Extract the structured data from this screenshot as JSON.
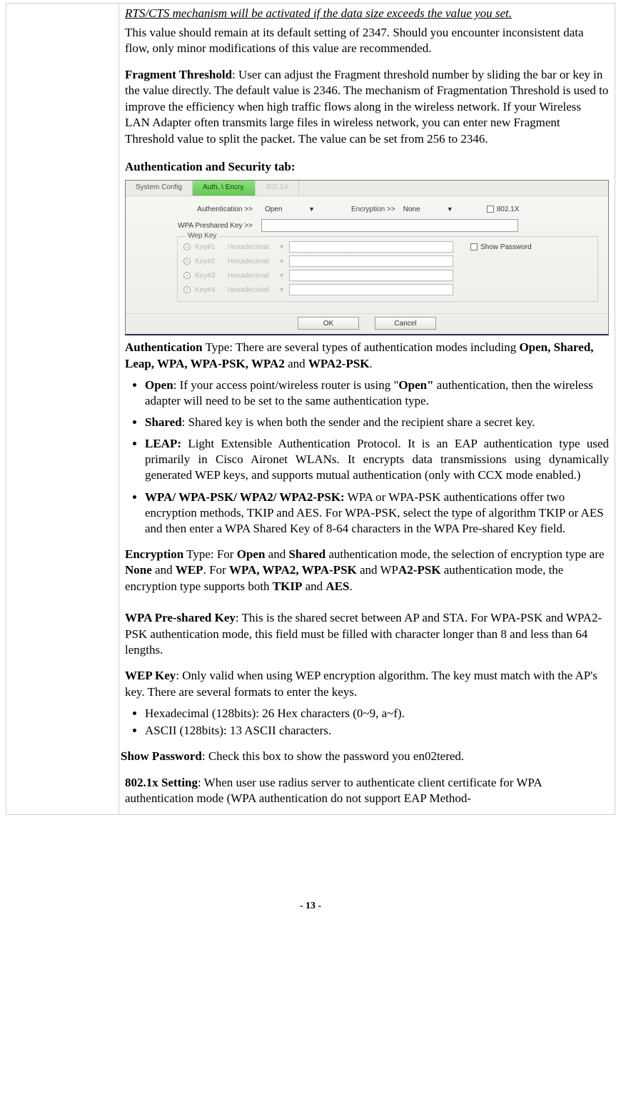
{
  "para_rts_note": "RTS/CTS mechanism will be activated if the data size exceeds the value you set.",
  "para_rts_default": "This value should remain at its default setting of 2347.   Should you encounter inconsistent data flow, only minor modifications of this value are recommended.",
  "frag_label": "Fragment Threshold",
  "frag_text": ": User can adjust the Fragment threshold number by sliding the bar or key in the value directly. The default value is 2346. The mechanism of Fragmentation Threshold is used to improve the efficiency when high traffic flows along in the wireless network. If your Wireless LAN Adapter often transmits large files in wireless network, you can enter new Fragment Threshold value to split the packet.   The value can be set from 256 to 2346.",
  "auth_sec_title": "Authentication and Security tab:",
  "ui": {
    "tabs": {
      "system": "System Config",
      "auth": "Auth. \\ Encry.",
      "dot1x": "802.1X"
    },
    "auth_lbl": "Authentication >>",
    "auth_val": "Open",
    "enc_lbl": "Encryption >>",
    "enc_val": "None",
    "cb_8021x": "802.1X",
    "psk_lbl": "WPA Preshared Key >>",
    "wep_legend": "Wep Key",
    "keys": [
      {
        "name": "Key#1",
        "fmt": "Hexadecimal"
      },
      {
        "name": "Key#2",
        "fmt": "Hexadecimal"
      },
      {
        "name": "Key#3",
        "fmt": "Hexadecimal"
      },
      {
        "name": "Key#4",
        "fmt": "Hexadecimal"
      }
    ],
    "show_pw": "Show Password",
    "ok": "OK",
    "cancel": "Cancel"
  },
  "auth_type_lead_b": "Authentication",
  "auth_type_lead_rest": " Type: There are several types of authentication modes including ",
  "auth_type_list_b": "Open, Shared, Leap, WPA, WPA-PSK, WPA2",
  "auth_type_and": " and ",
  "auth_type_last_b": "WPA2-PSK",
  "bullets_auth": {
    "open_b": "Open",
    "open_t1": ": If your access point/wireless router is using \"",
    "open_t1b": "Open\"",
    "open_t2": " authentication, then the wireless adapter will need to be set to the same authentication type.",
    "shared_b": "Shared",
    "shared_t": ": Shared key is when both the sender and the recipient share a secret key.",
    "leap_b": "LEAP:",
    "leap_t": " Light Extensible Authentication Protocol. It is an EAP authentication type used primarily in Cisco Aironet WLANs. It encrypts data transmissions using dynamically generated WEP keys, and supports mutual authentication (only with CCX mode enabled.)",
    "wpa_b": "WPA/ WPA-PSK/ WPA2/ WPA2-PSK:",
    "wpa_t": " WPA or WPA-PSK authentications offer two encryption methods, TKIP and AES. For WPA-PSK, select the type of algorithm TKIP or AES and then enter a WPA Shared Key of 8-64 characters in the WPA Pre-shared Key field."
  },
  "enc_b": "Encryption",
  "enc_t1": " Type: For ",
  "enc_b2": "Open",
  "enc_t2": " and ",
  "enc_b3": "Shared",
  "enc_t3": " authentication mode, the selection of encryption type are ",
  "enc_b4": "None",
  "enc_t4": " and ",
  "enc_b5": "WEP",
  "enc_t5": ". For ",
  "enc_b6": "WPA, WPA2, WPA-PSK",
  "enc_t6": " and WP",
  "enc_b7": "A2-PSK",
  "enc_t7": " authentication mode, the encryption type supports both ",
  "enc_b8": "TKIP",
  "enc_t8": " and ",
  "enc_b9": "AES",
  "enc_t9": ".",
  "psk_b": "WPA Pre-shared Key",
  "psk_t": ": This is the shared secret between AP and STA. For WPA-PSK and WPA2-PSK authentication mode, this field must be filled with character longer than 8 and less than 64 lengths.",
  "wep_b": "WEP Key",
  "wep_t": ": Only valid when using WEP encryption algorithm. The key must match with the AP's key. There are several formats to enter the keys.",
  "wep_bullets": {
    "hex": "Hexadecimal (128bits): 26 Hex characters (0~9, a~f).",
    "ascii": "ASCII (128bits): 13 ASCII characters."
  },
  "showpw_b": "Show Password",
  "showpw_t": ": Check this box to show the password you en02tered.",
  "dot1x_b": "802.1x Setting",
  "dot1x_t": ": When user use radius server to authenticate client certificate for WPA authentication mode (WPA authentication do not support EAP Method-",
  "footer": "- 13 -"
}
